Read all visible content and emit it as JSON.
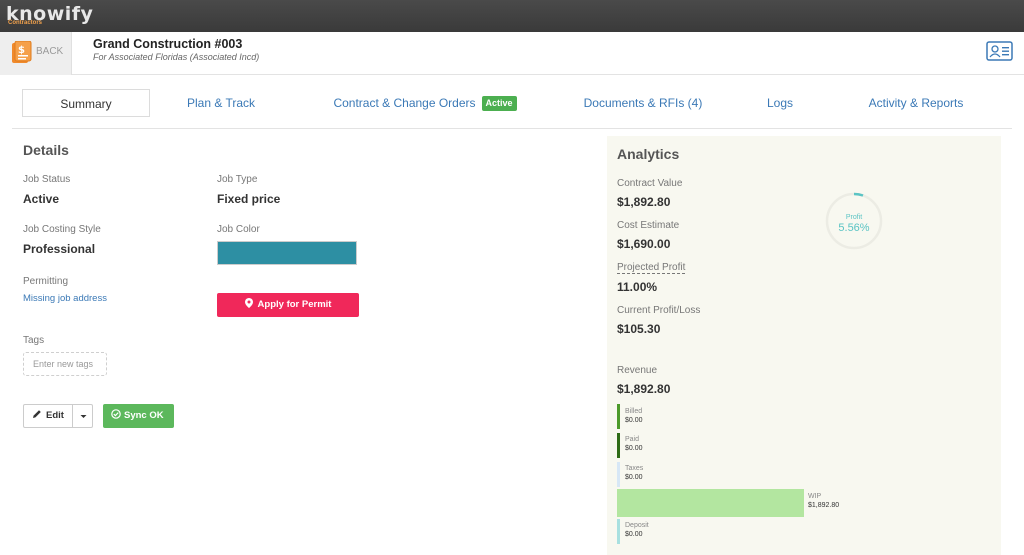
{
  "app": {
    "logo": "knowify",
    "logo_sub": "Contractors"
  },
  "header": {
    "back_label": "BACK",
    "job_title": "Grand Construction #003",
    "job_subtitle": "For Associated Floridas (Associated Incd)",
    "back_icon": "document-dollar-icon",
    "contact_icon": "contact-card-icon"
  },
  "tabs": [
    {
      "label": "Summary"
    },
    {
      "label": "Plan & Track"
    },
    {
      "label": "Contract & Change Orders",
      "badge": "Active"
    },
    {
      "label": "Documents & RFIs (4)"
    },
    {
      "label": "Logs"
    },
    {
      "label": "Activity & Reports"
    }
  ],
  "details": {
    "title": "Details",
    "job_status_label": "Job Status",
    "job_status_value": "Active",
    "job_type_label": "Job Type",
    "job_type_value": "Fixed price",
    "costing_label": "Job Costing Style",
    "costing_value": "Professional",
    "job_color_label": "Job Color",
    "job_color": "#2d8fa3",
    "permitting_label": "Permitting",
    "permitting_link": "Missing job address",
    "permit_button": "Apply for Permit",
    "tags_label": "Tags",
    "tags_placeholder": "Enter new tags",
    "edit_button": "Edit",
    "sync_button": "Sync OK"
  },
  "analytics": {
    "title": "Analytics",
    "contract_value_label": "Contract Value",
    "contract_value": "$1,892.80",
    "cost_estimate_label": "Cost Estimate",
    "cost_estimate": "$1,690.00",
    "projected_profit_label": "Projected Profit",
    "projected_profit": "11.00%",
    "current_profit_label": "Current Profit/Loss",
    "current_profit": "$105.30",
    "gauge_label": "Profit",
    "gauge_value": "5.56%",
    "revenue_label": "Revenue",
    "revenue_value": "$1,892.80",
    "revenue_breakdown": [
      {
        "label": "Billed",
        "value": "$0.00",
        "color": "#4c9a2a"
      },
      {
        "label": "Paid",
        "value": "$0.00",
        "color": "#2e6b16"
      },
      {
        "label": "Taxes",
        "value": "$0.00",
        "color": "#d7e7f6"
      },
      {
        "label": "WIP",
        "value": "$1,892.80",
        "color": "#b3e6a0"
      },
      {
        "label": "Deposit",
        "value": "$0.00",
        "color": "#a8e0e0"
      }
    ]
  },
  "colors": {
    "accent_link": "#3b79b6",
    "permit_red": "#f0285a",
    "sync_green": "#5cb85c",
    "badge_green": "#4caf50"
  }
}
